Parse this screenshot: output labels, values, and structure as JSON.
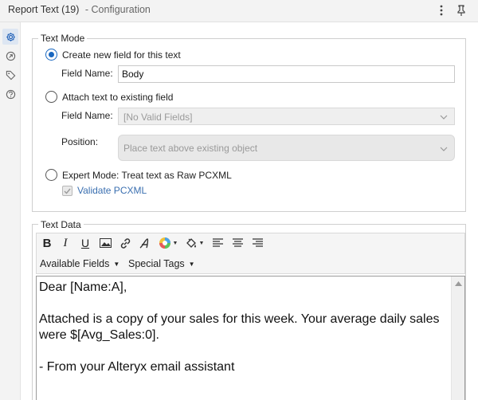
{
  "header": {
    "tool_name": "Report Text (19)",
    "section": "- Configuration"
  },
  "text_mode": {
    "legend": "Text Mode",
    "option_create": "Create new field for this text",
    "field_name_label": "Field Name:",
    "field_name_value": "Body",
    "option_attach": "Attach text to existing field",
    "attach_field_label": "Field Name:",
    "attach_field_value": "[No Valid Fields]",
    "position_label": "Position:",
    "position_value": "Place text above existing object",
    "option_expert": "Expert Mode: Treat text as Raw PCXML",
    "validate_label": "Validate PCXML",
    "selected_option": "create"
  },
  "text_data": {
    "legend": "Text Data",
    "available_fields": "Available Fields",
    "special_tags": "Special Tags",
    "line1": "Dear [Name:A],",
    "line2": "Attached is a copy of your sales for this week. Your average daily sales were $[Avg_Sales:0].",
    "line3": "- From your Alteryx email assistant"
  },
  "colors": {
    "accent": "#1967c0",
    "header_bg": "#f3f3f3"
  },
  "icons": {
    "header": [
      "more-vertical-icon",
      "pin-icon"
    ],
    "rail": [
      "gear-icon",
      "output-connections-icon",
      "tag-icon",
      "help-icon"
    ],
    "toolbar": [
      "bold-icon",
      "italic-icon",
      "underline-icon",
      "image-icon",
      "link-icon",
      "font-icon",
      "font-color-icon",
      "fill-color-icon",
      "align-left-icon",
      "align-center-icon",
      "align-right-icon"
    ]
  }
}
